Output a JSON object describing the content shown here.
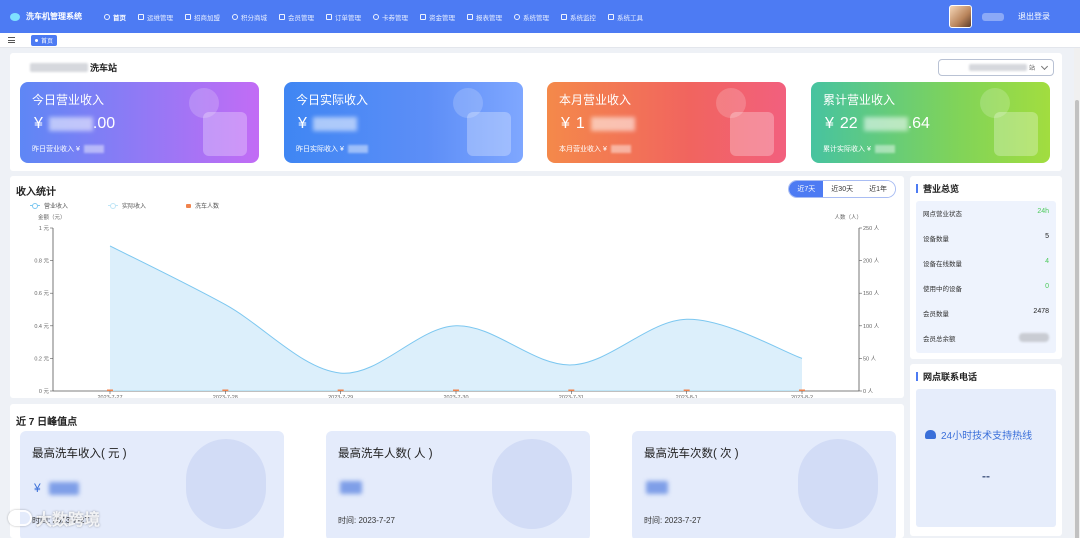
{
  "app": {
    "title": "洗车机管理系统",
    "logout_label": "退出登录"
  },
  "nav": [
    {
      "label": "首页",
      "icon": "home-icon",
      "active": true
    },
    {
      "label": "运维管理",
      "icon": "monitor-icon"
    },
    {
      "label": "招商加盟",
      "icon": "handshake-icon"
    },
    {
      "label": "积分商城",
      "icon": "store-icon"
    },
    {
      "label": "会员管理",
      "icon": "member-icon"
    },
    {
      "label": "订单管理",
      "icon": "order-icon"
    },
    {
      "label": "卡券管理",
      "icon": "coupon-icon"
    },
    {
      "label": "资金管理",
      "icon": "money-icon"
    },
    {
      "label": "报表管理",
      "icon": "report-icon"
    },
    {
      "label": "系统管理",
      "icon": "gear-icon"
    },
    {
      "label": "系统监控",
      "icon": "monitor-screen-icon"
    },
    {
      "label": "系统工具",
      "icon": "tools-icon"
    }
  ],
  "tabs": {
    "home_label": "首页"
  },
  "station": {
    "name_suffix": "洗车站",
    "select_suffix": "站"
  },
  "stat_cards": [
    {
      "title": "今日营业收入",
      "currency": "¥",
      "value_visible": ".00",
      "sub_label": "昨日营业收入 ¥"
    },
    {
      "title": "今日实际收入",
      "currency": "¥",
      "value_visible": "",
      "sub_label": "昨日实际收入 ¥"
    },
    {
      "title": "本月营业收入",
      "currency": "¥",
      "value_visible": "1",
      "sub_label": "本月营业收入 ¥"
    },
    {
      "title": "累计营业收入",
      "currency": "¥",
      "value_visible": "22",
      "value_tail": ".64",
      "sub_label": "累计实际收入 ¥"
    }
  ],
  "income": {
    "title": "收入统计",
    "ranges": [
      "近7天",
      "近30天",
      "近1年"
    ],
    "active_range": "近7天",
    "legend": [
      "营业收入",
      "实际收入",
      "洗车人数"
    ]
  },
  "chart_data": {
    "type": "area",
    "x": [
      "2023-7-27",
      "2023-7-28",
      "2023-7-29",
      "2023-7-30",
      "2023-7-31",
      "2023-8-1",
      "2023-8-2"
    ],
    "series": [
      {
        "name": "营业收入",
        "axis": "left",
        "values": [
          0.89,
          0.53,
          0.11,
          0.4,
          0.16,
          0.44,
          0.2
        ]
      },
      {
        "name": "实际收入",
        "axis": "left",
        "values": [
          0,
          0,
          0,
          0,
          0,
          0,
          0
        ]
      },
      {
        "name": "洗车人数",
        "axis": "right",
        "values": [
          0,
          0,
          0,
          0,
          0,
          0,
          0
        ]
      }
    ],
    "ylabel_left": "金额（元）",
    "ylabel_right": "人数（人）",
    "yticks_left": [
      "0 元",
      "0.2 元",
      "0.4 元",
      "0.6 元",
      "0.8 元",
      "1 元"
    ],
    "yticks_right": [
      "0 人",
      "50 人",
      "100 人",
      "150 人",
      "200 人",
      "250 人"
    ],
    "ylim_left": [
      0,
      1
    ],
    "ylim_right": [
      0,
      250
    ],
    "colors": {
      "revenue": "#7cc7f0",
      "revenue_fill": "#d6ecfa",
      "actual": "#bfe5f6",
      "visitors": "#f0834d"
    }
  },
  "overview": {
    "title": "营业总览",
    "rows": [
      {
        "label": "网点营业状态",
        "value": "24h",
        "style": "green"
      },
      {
        "label": "设备数量",
        "value": "5",
        "style": "dark"
      },
      {
        "label": "设备在线数量",
        "value": "4",
        "style": "green"
      },
      {
        "label": "使用中的设备",
        "value": "0",
        "style": "green"
      },
      {
        "label": "会员数量",
        "value": "2478",
        "style": "dark"
      },
      {
        "label": "会员总余额",
        "value": "",
        "style": "masked"
      }
    ]
  },
  "contact": {
    "title": "网点联系电话",
    "hotline_label": "24小时技术支持热线",
    "hotline_value": "--"
  },
  "peaks": {
    "title": "近 7 日峰值点",
    "cards": [
      {
        "title": "最高洗车收入( 元 )",
        "prefix": "¥",
        "date_label": "时间: ",
        "date": "2023-7-27"
      },
      {
        "title": "最高洗车人数( 人 )",
        "prefix": "",
        "date_label": "时间: ",
        "date": "2023-7-27"
      },
      {
        "title": "最高洗车次数( 次 )",
        "prefix": "",
        "date_label": "时间: ",
        "date": "2023-7-27"
      }
    ]
  },
  "watermark": "大数跨境"
}
